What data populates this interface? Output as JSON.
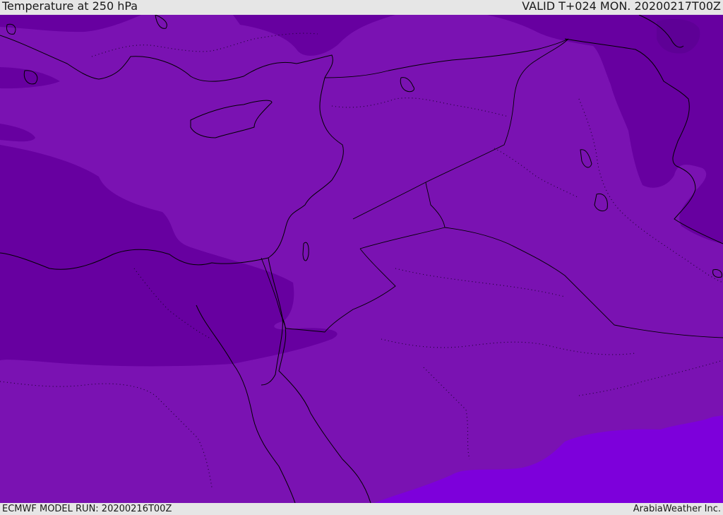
{
  "header": {
    "title": "Temperature at 250 hPa",
    "valid": "VALID T+024 MON. 20200217T00Z"
  },
  "footer": {
    "model_run": "ECMWF MODEL RUN: 20200216T00Z",
    "credit": "ArabiaWeather Inc."
  },
  "colors": {
    "shade_main": "#7a12b2",
    "shade_cold": "#6700a0",
    "shade_colder": "#5e0096",
    "shade_warm": "#7d00db",
    "coastline": "#000000",
    "background": "#e6e6e6"
  }
}
